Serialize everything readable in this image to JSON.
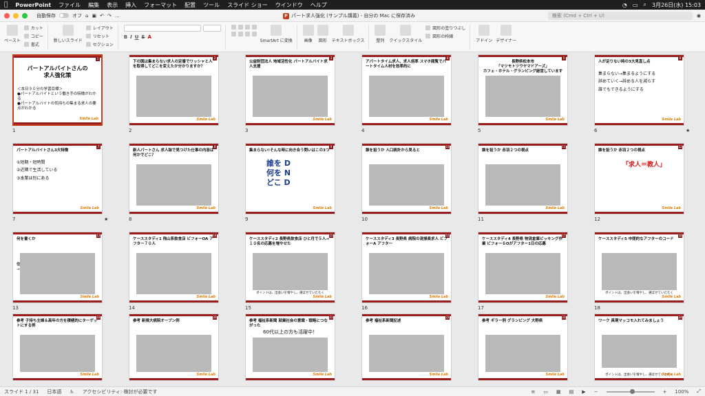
{
  "menubar": {
    "app": "PowerPoint",
    "items": [
      "ファイル",
      "編集",
      "表示",
      "挿入",
      "フォーマット",
      "配置",
      "ツール",
      "スライド ショー",
      "ウインドウ",
      "ヘルプ"
    ],
    "clock": "3月26日(水) 15:03"
  },
  "titlebar": {
    "autosave_label": "自動保存",
    "autosave_state": "オフ",
    "title": "パート求人強化 (サンプル講義) - 自分の Mac に保存済み",
    "search_placeholder": "検索 (Cmd + Ctrl + U)"
  },
  "ribbon": {
    "paste": "ペースト",
    "cut": "カット",
    "copy": "コピー",
    "format": "書式",
    "new_slide": "新しいスライド",
    "layout": "レイアウト",
    "reset": "リセット",
    "section": "セクション",
    "smartart": "SmartArt に変換",
    "picture": "画像",
    "shapes": "図形",
    "textbox": "テキストボックス",
    "arrange": "整列",
    "quickstyles": "クイックスタイル",
    "fill": "図形の塗りつぶし",
    "outline": "図形の枠線",
    "designer": "アドイン",
    "design": "デザイナー"
  },
  "slides": [
    {
      "n": "1",
      "title": "パートアルバイトさんの\n求人強化策",
      "sub": "＜本日９０分の学習目標＞\n●パートアルバイトという働き手の特徴がわかる\n●パートアルバイトの気持ちの集まる求人の要点がわかる",
      "star": ""
    },
    {
      "n": "2",
      "title": "下の図は集まらない求人の定番でワッシャと⼈を取得してどこを変えたか分かりますか？",
      "sub": "",
      "star": ""
    },
    {
      "n": "3",
      "title": "公益財団法人 地域活性化 パートアルバイト求人支援",
      "sub": "",
      "star": ""
    },
    {
      "n": "4",
      "title": "アパートタイム求人、求人倍率 スマホ閲覧でパートタイム人材を効率的に",
      "sub": "",
      "star": ""
    },
    {
      "n": "5",
      "title": "長野県松本市\n「マツモトツウヤマドアーズ」\nカフェ・ホテル・グランピング経営しています",
      "sub": "",
      "star": ""
    },
    {
      "n": "6",
      "title": "人が足りない時の3大見直し点",
      "sub": "集まらない→集まるようにする\n辞めていく→辞める人を減らす\n誰でもできるようにする",
      "star": "★"
    },
    {
      "n": "7",
      "title": "パートアルバイトさん3大特徴",
      "sub": "①短期・短時間\n②近隣で生活している\n③本業は別にある",
      "star": "★"
    },
    {
      "n": "8",
      "title": "新人パートさん 求人誌で見つけた仕事の内容は何かでどこ？",
      "sub": "",
      "star": ""
    },
    {
      "n": "9",
      "title": "集まらない!そんな時に向き合う問いはこの3つ",
      "sub": "誰を D\n何を N\nどこ D",
      "star": ""
    },
    {
      "n": "10",
      "title": "誰を狙うか 人口統計から見ると",
      "sub": "",
      "star": ""
    },
    {
      "n": "11",
      "title": "誰を狙うか 赤羽２つの視点",
      "sub": "",
      "star": ""
    },
    {
      "n": "12",
      "title": "誰を狙うか 赤羽２つの視点",
      "sub": "「求人＝教人」",
      "star": ""
    },
    {
      "n": "13",
      "title": "何を書くか",
      "sub": "働きたい人たちの困りごとは何か？\n→求人原稿に絶対に載せる！",
      "star": ""
    },
    {
      "n": "14",
      "title": "ケーススタディ1 飛山系飲食店 ビフォーOA アフター７０人",
      "sub": "",
      "star": ""
    },
    {
      "n": "15",
      "title": "ケーススタディ2 長野県飲食店 ひと月で５人→１０名の応募を増やせた",
      "sub": "ポイントは、出会いを増やし、選ばせていたたく",
      "star": ""
    },
    {
      "n": "16",
      "title": "ケーススタディ3 長野県 病院の清掃員求人 ビフォーA アフター",
      "sub": "",
      "star": ""
    },
    {
      "n": "17",
      "title": "ケーススタディ4 長野県 物流倉庫ピッキング作業 ビフォー６Oがアフター1日の応募",
      "sub": "",
      "star": ""
    },
    {
      "n": "18",
      "title": "ケーススタディ5 中間的なアフターのコード",
      "sub": "ポイントは、出会いを増やし、選ばせていたたく",
      "star": ""
    },
    {
      "n": "19",
      "title": "参考 子持ち主婦＆高年の方を積極的にターゲットにする例",
      "sub": "",
      "star": ""
    },
    {
      "n": "20",
      "title": "参考 新規大病院オープン例",
      "sub": "",
      "star": ""
    },
    {
      "n": "21",
      "title": "参考 福祉系新聞 就業社会の意識・戦略につながった",
      "sub": "60代以上の方も活躍中！",
      "star": ""
    },
    {
      "n": "22",
      "title": "参考 福祉系新聞記述",
      "sub": "",
      "star": ""
    },
    {
      "n": "23",
      "title": "参考 ギラー例 グランピング 大野県",
      "sub": "",
      "star": ""
    },
    {
      "n": "24",
      "title": "ワーク 具現マッコモ入れてみましょう",
      "sub": "ポイントは、出会いを増やし、選ばせていたたく",
      "star": ""
    }
  ],
  "logo_text": "Smile Lab",
  "statusbar": {
    "slide_counter": "スライド 1 / 31",
    "language": "日本語",
    "accessibility": "アクセシビリティ: 検討が必要です",
    "zoom": "100%"
  },
  "colors": {
    "accent": "#9b1c1c",
    "selection": "#c43e1c"
  }
}
